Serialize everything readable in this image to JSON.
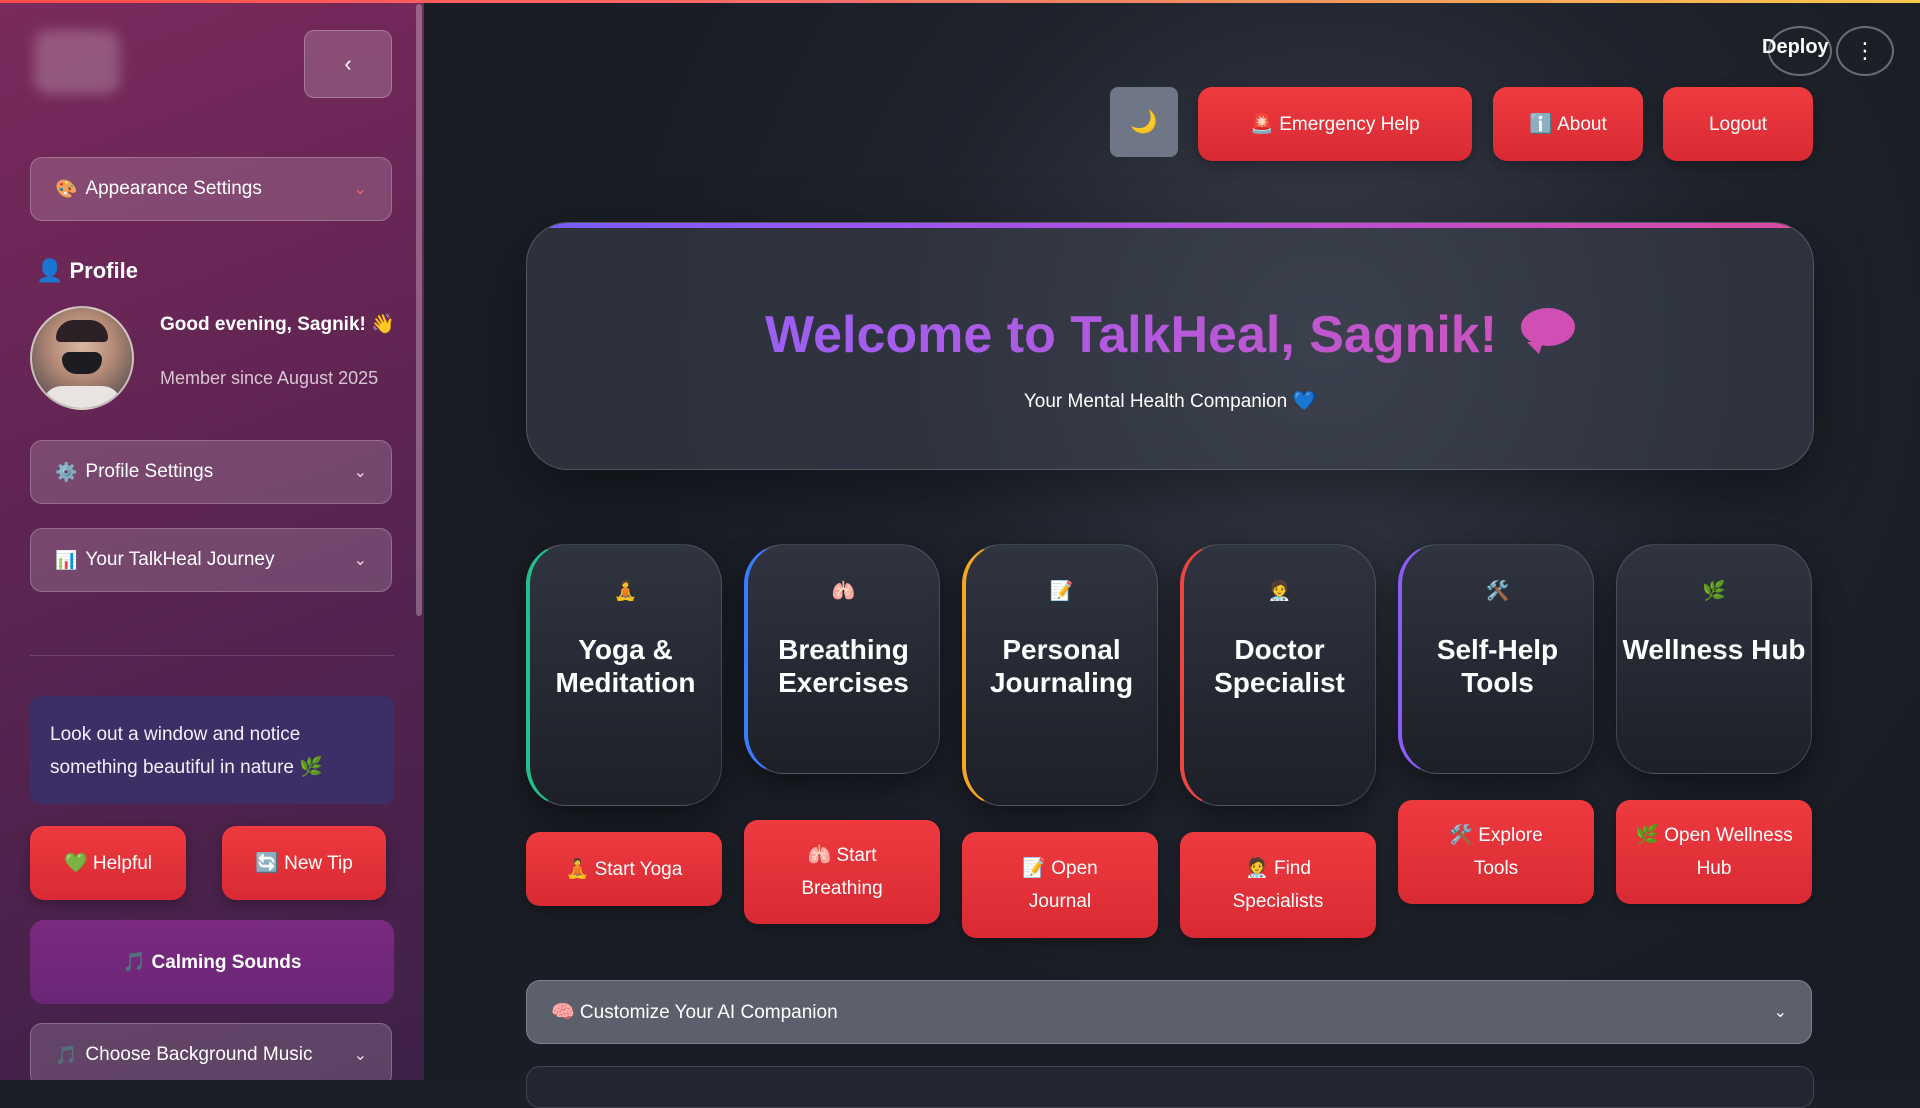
{
  "header": {
    "deploy_label": "Deploy",
    "menu_icon": "⋮",
    "theme_icon": "🌙",
    "emergency_label": "🚨 Emergency Help",
    "about_label": "ℹ️ About",
    "logout_label": "Logout"
  },
  "sidebar": {
    "collapse_icon": "‹",
    "appearance_label": "Appearance Settings",
    "appearance_icon": "🎨",
    "profile_title": "👤 Profile",
    "greeting": "Good evening, Sagnik! 👋",
    "member_since": "Member since August 2025",
    "profile_settings_label": "Profile Settings",
    "profile_settings_icon": "⚙️",
    "journey_label": "Your TalkHeal Journey",
    "journey_icon": "📊",
    "tip_text": "Look out a window and notice something beautiful in nature 🌿",
    "helpful_label": "💚 Helpful",
    "new_tip_label": "🔄 New Tip",
    "calming_label": "🎵 Calming Sounds",
    "music_label": "Choose Background Music",
    "music_icon": "🎵",
    "chevron": "⌄"
  },
  "hero": {
    "title": "Welcome to TalkHeal, Sagnik!",
    "subtitle": "Your Mental Health Companion 💙"
  },
  "features": [
    {
      "icon": "🧘",
      "title": "Yoga & Meditation",
      "button": "🧘 Start Yoga",
      "accent": "#22c08a"
    },
    {
      "icon": "🫁",
      "title": "Breathing Exercises",
      "button": "🫁 Start Breathing",
      "accent": "#3b7cff"
    },
    {
      "icon": "📝",
      "title": "Personal Journaling",
      "button": "📝 Open Journal",
      "accent": "#f5a623"
    },
    {
      "icon": "🧑‍⚕️",
      "title": "Doctor Specialist",
      "button": "🧑‍⚕️ Find Specialists",
      "accent": "#ef4444"
    },
    {
      "icon": "🛠️",
      "title": "Self-Help Tools",
      "button": "🛠️ Explore Tools",
      "accent": "#8b5cf6"
    },
    {
      "icon": "🌿",
      "title": "Wellness Hub",
      "button": "🌿 Open Wellness Hub",
      "accent": "#5b606c"
    }
  ],
  "ai_companion": {
    "label": "🧠 Customize Your AI Companion",
    "chevron": "⌄"
  },
  "colors": {
    "primary_red": "#e5343a",
    "sidebar_top": "#7a2a5b",
    "hero_gradient_start": "#8e62ff",
    "hero_gradient_end": "#dd4fa8"
  }
}
